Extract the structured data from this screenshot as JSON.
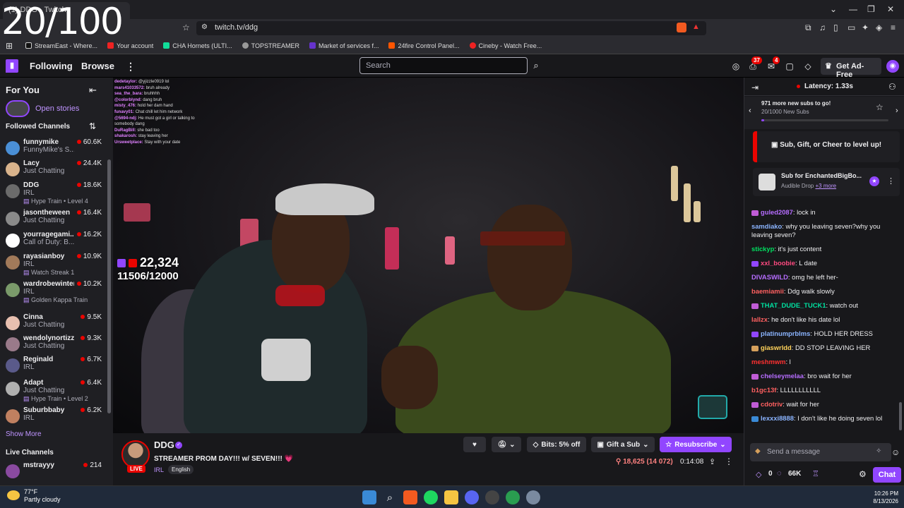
{
  "overlay_counter": "20/100",
  "browser": {
    "tab_title": "(1) DDG - Twitch",
    "url": "twitch.tv/ddg",
    "bookmarks": [
      {
        "label": "StreamEast - Where...",
        "color": "#222"
      },
      {
        "label": "Your account",
        "color": "#e22"
      },
      {
        "label": "CHA Hornets (ULTI...",
        "color": "#1d9"
      },
      {
        "label": "TOPSTREAMER",
        "color": "#999"
      },
      {
        "label": "Market of services f...",
        "color": "#63c"
      },
      {
        "label": "24fire Control Panel...",
        "color": "#f50"
      },
      {
        "label": "Cineby - Watch Free...",
        "color": "#e22"
      }
    ]
  },
  "nav": {
    "following": "Following",
    "browse": "Browse",
    "search_placeholder": "Search",
    "badge_notifications": "37",
    "badge_inbox": "4",
    "get_ad_free": "Get Ad-Free"
  },
  "sidebar": {
    "title": "For You",
    "open_stories": "Open stories",
    "followed_heading": "Followed Channels",
    "channels": [
      {
        "name": "funnymike",
        "game": "FunnyMike's S...",
        "extra": "",
        "viewers": "60.6K",
        "color": "#4a8fd6"
      },
      {
        "name": "Lacy",
        "game": "Just Chatting",
        "extra": "",
        "viewers": "24.4K",
        "color": "#d9b38c"
      },
      {
        "name": "DDG",
        "game": "IRL",
        "extra": "Hype Train • Level 4",
        "viewers": "18.6K",
        "color": "#6b6b6b"
      },
      {
        "name": "jasontheween",
        "game": "Just Chatting",
        "extra": "",
        "viewers": "16.4K",
        "color": "#8a8a8a"
      },
      {
        "name": "yourragegami...",
        "game": "Call of Duty: B...",
        "extra": "",
        "viewers": "16.2K",
        "color": "#ffffff"
      },
      {
        "name": "rayasianboy",
        "game": "IRL",
        "extra": "Watch Streak 1",
        "viewers": "10.9K",
        "color": "#a27a5a"
      },
      {
        "name": "wardrobewinter",
        "game": "IRL",
        "extra": "Golden Kappa Train",
        "viewers": "10.2K",
        "color": "#7a9a6a"
      },
      {
        "name": "Cinna",
        "game": "Just Chatting",
        "extra": "",
        "viewers": "9.5K",
        "color": "#e8c0b0"
      },
      {
        "name": "wendolynortizz",
        "game": "Just Chatting",
        "extra": "",
        "viewers": "9.3K",
        "color": "#9a7a8a"
      },
      {
        "name": "Reginald",
        "game": "IRL",
        "extra": "",
        "viewers": "6.7K",
        "color": "#5a5a8a"
      },
      {
        "name": "Adapt",
        "game": "Just Chatting",
        "extra": "Hype Train • Level 2",
        "viewers": "6.4K",
        "color": "#b0b0b0"
      },
      {
        "name": "Suburbbaby",
        "game": "IRL",
        "extra": "",
        "viewers": "6.2K",
        "color": "#c08060"
      }
    ],
    "show_more": "Show More",
    "live_heading": "Live Channels",
    "live": {
      "name": "mstrayyy",
      "game": "",
      "viewers": "214",
      "color": "#8a4aa0"
    }
  },
  "video": {
    "overlay_chat": [
      {
        "user": "dedetaylor:",
        "text": "@yjizzle0919 lol"
      },
      {
        "user": "",
        "text": ""
      },
      {
        "user": "mars41033572:",
        "text": "bruh already"
      },
      {
        "user": "sea_the_bara:",
        "text": "bruhhhh"
      },
      {
        "user": "@colorblynd:",
        "text": "dang bruh"
      },
      {
        "user": "misty_476:",
        "text": "hold her dam hand"
      },
      {
        "user": "funavy01:",
        "text": "Chat chill let him network"
      },
      {
        "user": "@5694-ndj:",
        "text": "He must got a girl or talking to somebody dang"
      },
      {
        "user": "DuRagBill:",
        "text": "she bad too"
      },
      {
        "user": "shakarosh:",
        "text": "stay leaving her"
      },
      {
        "user": "Ursweetplace:",
        "text": "Stay with your date"
      }
    ],
    "sub_count": "22,324",
    "sub_goal": "11506/12000"
  },
  "stream": {
    "name": "DDG",
    "title": "STREAMER PROM DAY!!! w/ SEVEN!!! 💗",
    "category": "IRL",
    "tag": "English",
    "live_label": "LIVE",
    "bits_label": "Bits: 5% off",
    "gift_label": "Gift a Sub",
    "resub_label": "Resubscribe",
    "viewers": "18,625 (14 072)",
    "uptime": "0:14:08"
  },
  "chat": {
    "latency": "Latency: 1.33s",
    "goal_line1": "971 more new subs to go!",
    "goal_line2": "20/1000 New Subs",
    "goal_progress": 0.02,
    "level_up": "Sub, Gift, or Cheer to level up!",
    "subfor_title": "Sub for EnchantedBigBo...",
    "subfor_sub": "Audible Drop",
    "subfor_more": "+3 more",
    "messages": [
      {
        "user": "guled2087",
        "text": ": lock in",
        "color": "#b66dff",
        "badge": "#c05cd6"
      },
      {
        "user": "samdiako",
        "text": ": why you leaving seven?why you leaving seven?",
        "color": "#8bb4ff",
        "badge": ""
      },
      {
        "user": "stickyp",
        "text": ": it's just content",
        "color": "#00e060",
        "badge": ""
      },
      {
        "user": "xxl_boobie",
        "text": ": L date",
        "color": "#ff4a80",
        "badge": "#9146ff"
      },
      {
        "user": "DIVASWILD",
        "text": ": omg he left her-",
        "color": "#b66dff",
        "badge": ""
      },
      {
        "user": "baemiamii",
        "text": ": Ddg walk slowly",
        "color": "#ff6060",
        "badge": ""
      },
      {
        "user": "THAT_DUDE_TUCK1",
        "text": ": watch out",
        "color": "#00e0a0",
        "badge": "#c05cd6"
      },
      {
        "user": "lallzx",
        "text": ": he don't like his date lol",
        "color": "#ff6060",
        "badge": ""
      },
      {
        "user": "platinumprblms",
        "text": ": HOLD HER DRESS",
        "color": "#8bb4ff",
        "badge": "#9146ff"
      },
      {
        "user": "giaswrldd",
        "text": ": DD STOP LEAVING HER",
        "color": "#ffd25a",
        "badge": "#d6a05c"
      },
      {
        "user": "meshmwm",
        "text": ": l",
        "color": "#ff3030",
        "badge": ""
      },
      {
        "user": "chelseymelaa",
        "text": ": bro wait for her",
        "color": "#b66dff",
        "badge": "#c05cd6"
      },
      {
        "user": "b1gc13f",
        "text": ": LLLLLLLLLLL",
        "color": "#ff6060",
        "badge": ""
      },
      {
        "user": "cdotriv",
        "text": ": wait for her",
        "color": "#ff6060",
        "badge": "#c05cd6"
      },
      {
        "user": "lexxxi8888",
        "text": ": I don't like he doing seven lol",
        "color": "#8bb4ff",
        "badge": "#3a8ad6"
      }
    ],
    "input_placeholder": "Send a message",
    "points": "0",
    "channel_points": "66K",
    "chat_button": "Chat"
  },
  "taskbar": {
    "temp": "77°F",
    "weather": "Partly cloudy",
    "time": "10:26 PM",
    "date": "8/13/2026"
  }
}
